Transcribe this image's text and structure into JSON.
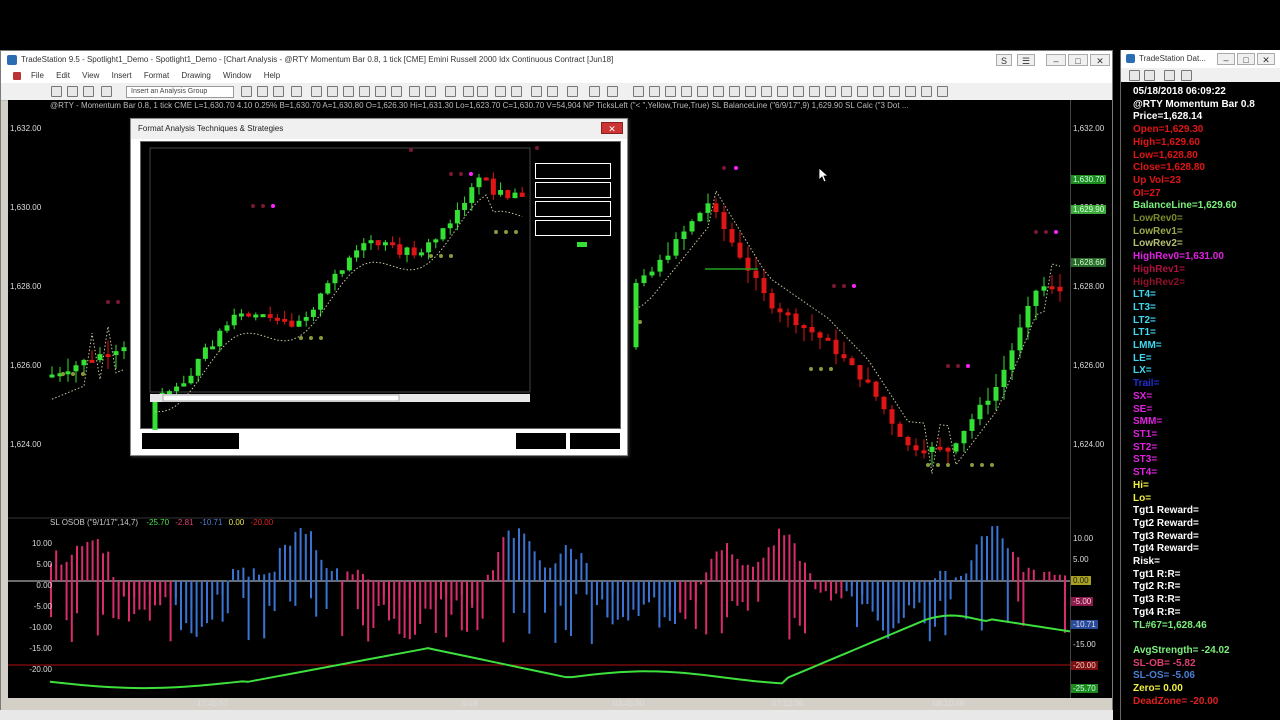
{
  "main_window": {
    "title": "TradeStation 9.5 - Spotlight1_Demo - Spotlight1_Demo - [Chart Analysis - @RTY Momentum Bar 0.8, 1 tick [CME] Emini Russell 2000 Idx Continuous Contract [Jun18]",
    "menu": [
      "File",
      "Edit",
      "View",
      "Insert",
      "Format",
      "Drawing",
      "Window",
      "Help"
    ],
    "analysis_group_placeholder": "Insert an Analysis Group"
  },
  "chart": {
    "study_header": "@RTY - Momentum Bar 0.8, 1 tick CME  L=1,630.70  4.10  0.25%  B=1,630.70  A=1,630.80  O=1,626.30  Hi=1,631.30  Lo=1,623.70  C=1,630.70  V=54,904  NP  TicksLeft (\"< \",Yellow,True,True)   SL  BalanceLine (\"6/9/17\",9)   1,629.90   SL  Calc (\"3 Dot ...",
    "price_labels": [
      "1,632.00",
      "1,630.00",
      "1,628.00",
      "1,626.00",
      "1,624.00"
    ],
    "price_flags": [
      "1,630.70",
      "1,629.90",
      "1,628.60"
    ],
    "osob_header_prefix": "SL  OSOB (\"9/1/17\",14,7)",
    "osob_values": [
      {
        "text": "-25.70",
        "color": "#4ce34c"
      },
      {
        "text": "-2.81",
        "color": "#e04070"
      },
      {
        "text": "-10.71",
        "color": "#4a7fd8"
      },
      {
        "text": "0.00",
        "color": "#e8e850"
      },
      {
        "text": "-20.00",
        "color": "#e02020"
      }
    ],
    "osc_labels_left": [
      "10.00",
      "5.00",
      "0.00",
      "-5.00",
      "-10.00",
      "-15.00",
      "-20.00"
    ],
    "osc_labels_right": [
      "10.00",
      "5.00",
      "0.00",
      "-5.00",
      "-10.71",
      "-15.00",
      "-20.00",
      "-25.70"
    ],
    "time_labels": [
      "17:45:57",
      "5/18",
      "03:45:30",
      "07:12:36",
      "08:10:48"
    ],
    "colors": {
      "up": "#33e033",
      "down": "#e01515",
      "dot_magenta": "#ff22ff",
      "dot_olive": "#8a9a3a",
      "balance": "#c8c8a0",
      "osc_up": "#d82c6c",
      "osc_down": "#3a74d0",
      "osc_line": "#3ee03e"
    }
  },
  "dialog": {
    "title": "Format Analysis Techniques & Strategies",
    "close_label": "✕"
  },
  "data_window": {
    "title": "TradeStation Dat...",
    "rows": [
      {
        "text": "05/18/2018 06:09:22",
        "color": "#ffffff"
      },
      {
        "text": "@RTY Momentum Bar 0.8",
        "color": "#ffffff"
      },
      {
        "text": "Price=1,628.14",
        "color": "#ffffff"
      },
      {
        "text": "Open=1,629.30",
        "color": "#e01515"
      },
      {
        "text": "High=1,629.60",
        "color": "#e01515"
      },
      {
        "text": "Low=1,628.80",
        "color": "#e01515"
      },
      {
        "text": "Close=1,628.80",
        "color": "#e01515"
      },
      {
        "text": "Up Vol=23",
        "color": "#e01515"
      },
      {
        "text": "OI=27",
        "color": "#e01515"
      },
      {
        "text": "BalanceLine=1,629.60",
        "color": "#7cf07c"
      },
      {
        "text": "LowRev0=",
        "color": "#7a8a2a"
      },
      {
        "text": "LowRev1=",
        "color": "#9aa84a"
      },
      {
        "text": "LowRev2=",
        "color": "#b8c070"
      },
      {
        "text": "HighRev0=1,631.00",
        "color": "#e022e0"
      },
      {
        "text": "HighRev1=",
        "color": "#b01040"
      },
      {
        "text": "HighRev2=",
        "color": "#90102a"
      },
      {
        "text": "LT4=",
        "color": "#40d8f0"
      },
      {
        "text": "LT3=",
        "color": "#40d8f0"
      },
      {
        "text": "LT2=",
        "color": "#40d8f0"
      },
      {
        "text": "LT1=",
        "color": "#40d8f0"
      },
      {
        "text": "LMM=",
        "color": "#40d8f0"
      },
      {
        "text": "LE=",
        "color": "#40d8f0"
      },
      {
        "text": "LX=",
        "color": "#40d8f0"
      },
      {
        "text": "Trail=",
        "color": "#2030d0"
      },
      {
        "text": "SX=",
        "color": "#e022e0"
      },
      {
        "text": "SE=",
        "color": "#e022e0"
      },
      {
        "text": "SMM=",
        "color": "#e022e0"
      },
      {
        "text": "ST1=",
        "color": "#e022e0"
      },
      {
        "text": "ST2=",
        "color": "#e022e0"
      },
      {
        "text": "ST3=",
        "color": "#e022e0"
      },
      {
        "text": "ST4=",
        "color": "#e022e0"
      },
      {
        "text": "Hi=",
        "color": "#f0f040"
      },
      {
        "text": "Lo=",
        "color": "#f0f040"
      },
      {
        "text": "Tgt1 Reward=",
        "color": "#ffffff"
      },
      {
        "text": "Tgt2 Reward=",
        "color": "#ffffff"
      },
      {
        "text": "Tgt3 Reward=",
        "color": "#ffffff"
      },
      {
        "text": "Tgt4 Reward=",
        "color": "#ffffff"
      },
      {
        "text": "Risk=",
        "color": "#ffffff"
      },
      {
        "text": "Tgt1 R:R=",
        "color": "#ffffff"
      },
      {
        "text": "Tgt2 R:R=",
        "color": "#ffffff"
      },
      {
        "text": "Tgt3 R:R=",
        "color": "#ffffff"
      },
      {
        "text": "Tgt4 R:R=",
        "color": "#ffffff"
      },
      {
        "text": "TL#67=1,628.46",
        "color": "#7cf07c"
      },
      {
        "text": "",
        "color": "#ffffff"
      },
      {
        "text": "AvgStrength= -24.02",
        "color": "#7cf07c"
      },
      {
        "text": "SL-OB= -5.82",
        "color": "#e04070"
      },
      {
        "text": "SL-OS= -5.06",
        "color": "#4a7fd8"
      },
      {
        "text": "Zero= 0.00",
        "color": "#f0f040"
      },
      {
        "text": "DeadZone= -20.00",
        "color": "#e02020"
      }
    ]
  }
}
